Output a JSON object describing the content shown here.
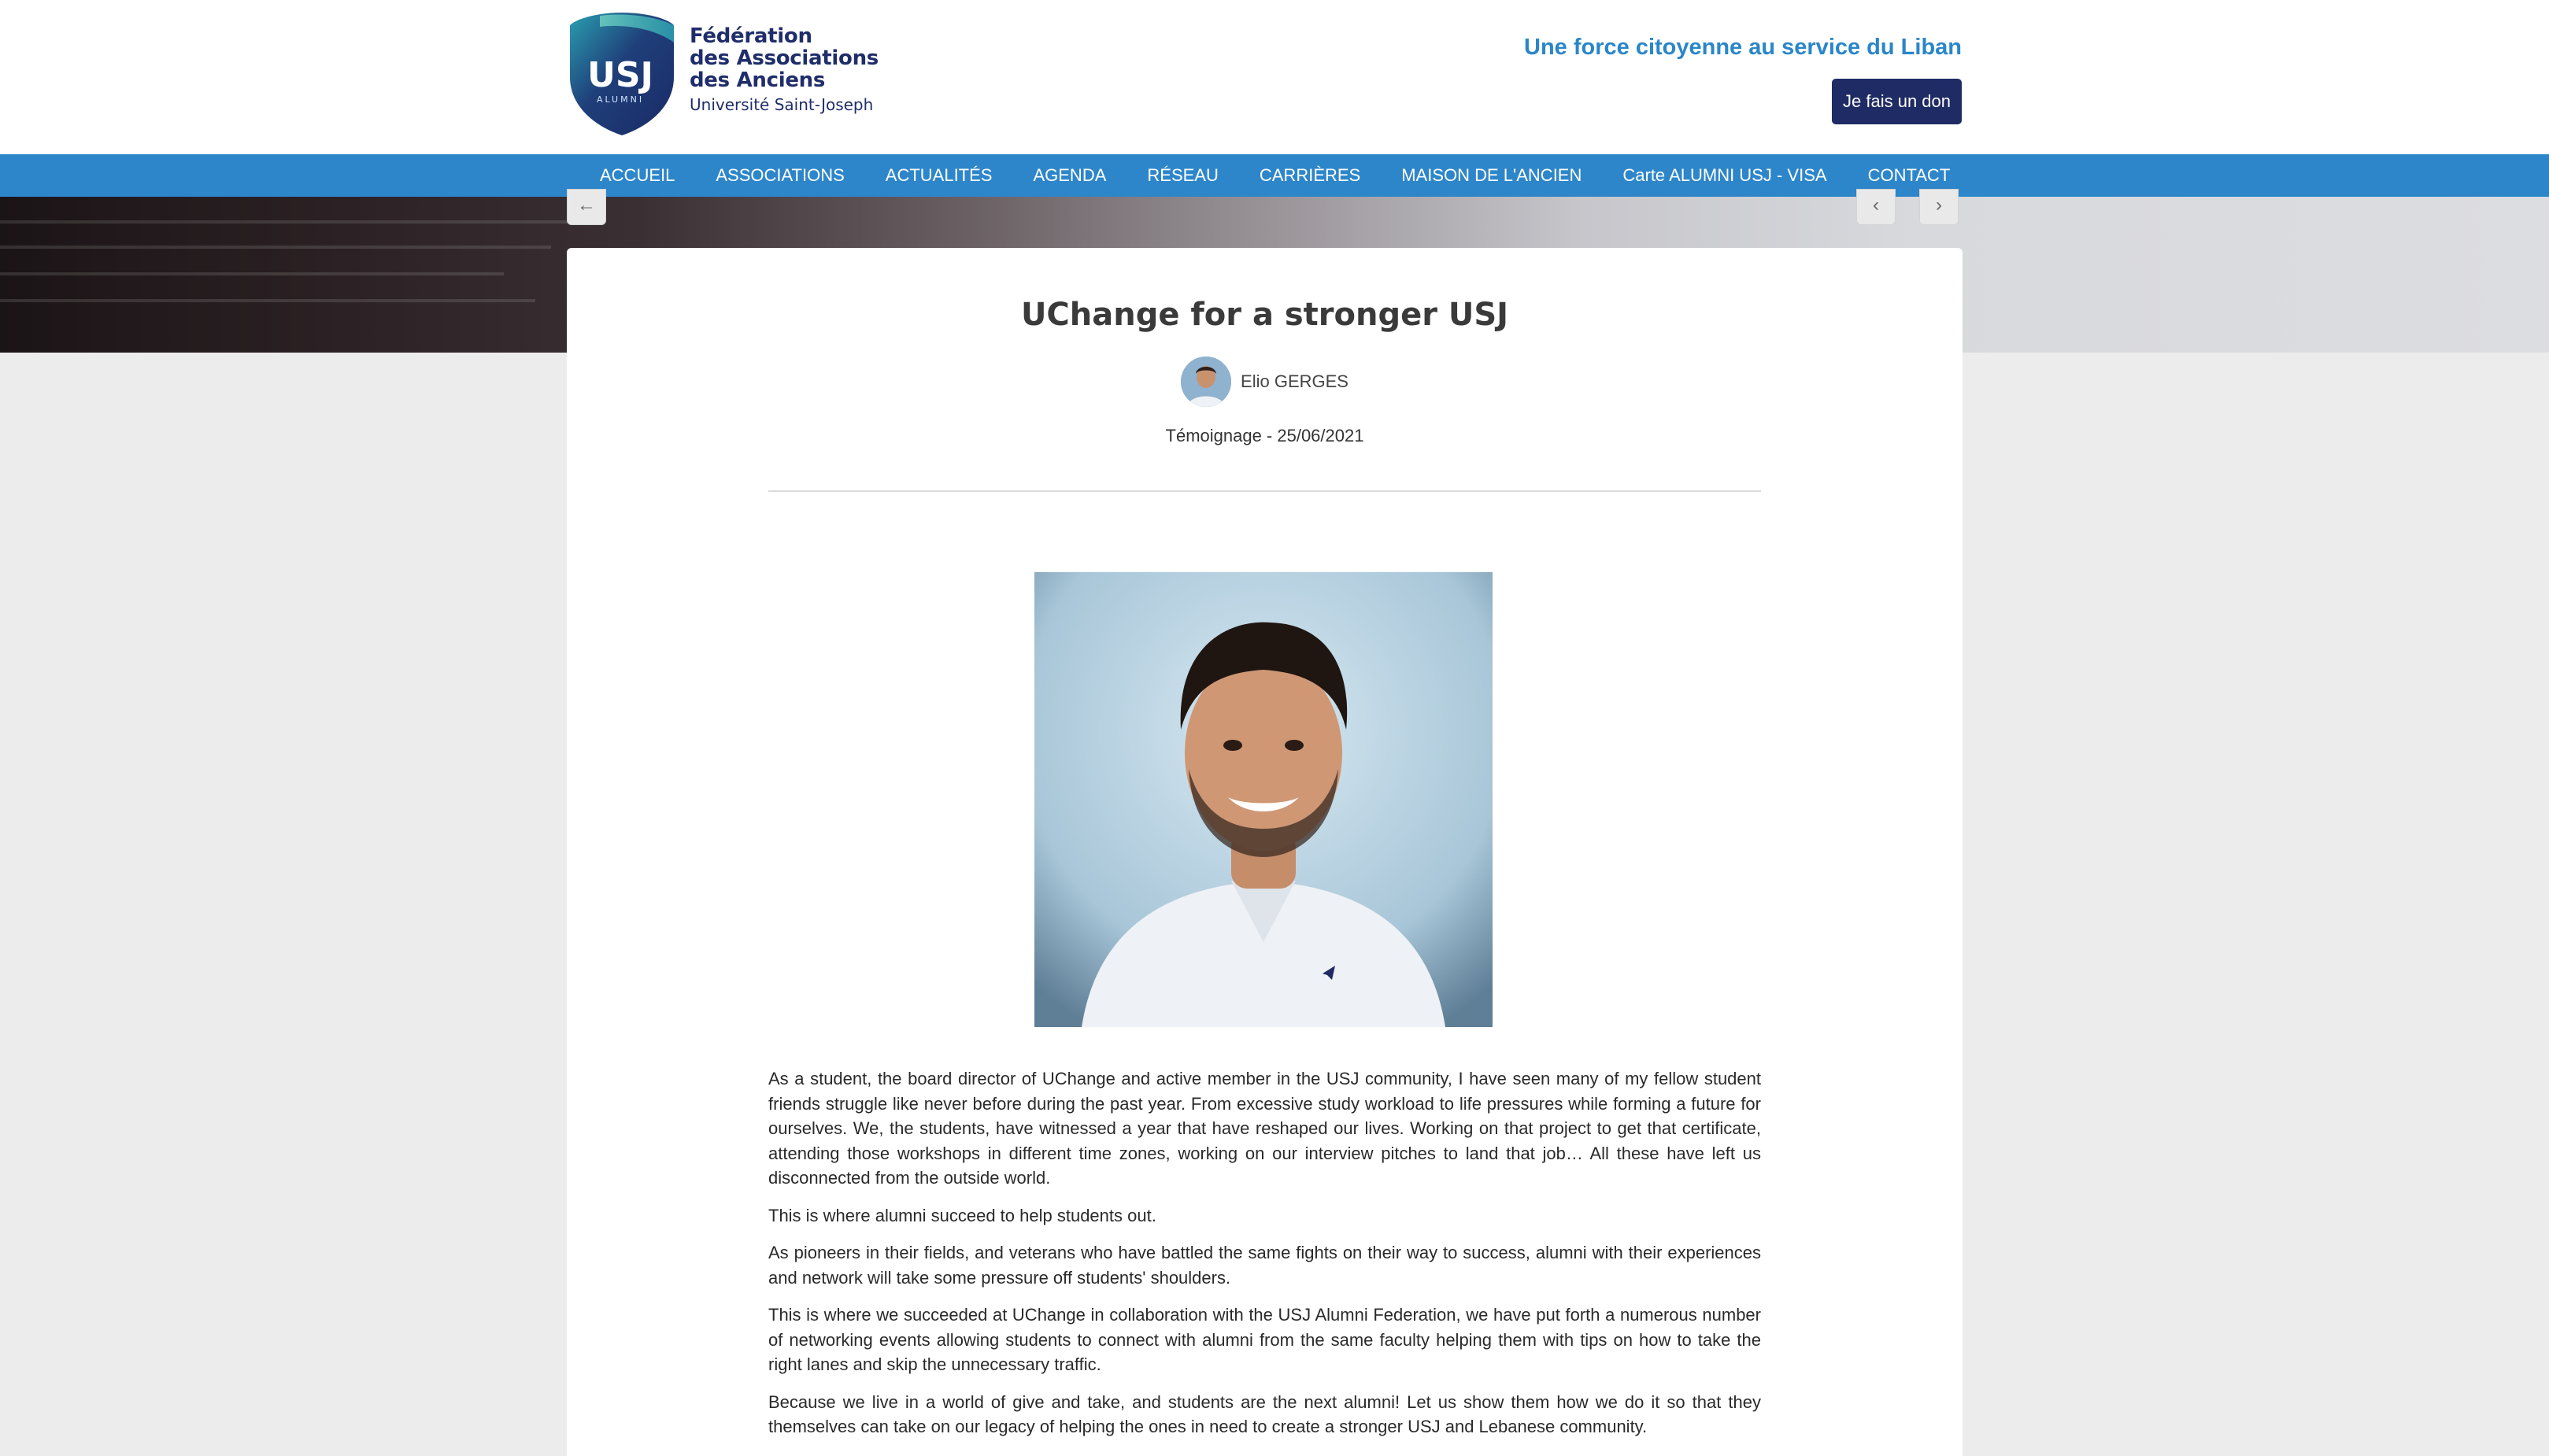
{
  "header": {
    "logo": {
      "shield_text": "USJ",
      "shield_sub": "ALUMNI",
      "lines": [
        "Fédération",
        "des Associations",
        "des Anciens"
      ],
      "sub": "Université Saint-Joseph"
    },
    "tagline": "Une force citoyenne au service du Liban",
    "donate_label": "Je fais un don"
  },
  "nav": {
    "items": [
      "ACCUEIL",
      "ASSOCIATIONS",
      "ACTUALITÉS",
      "AGENDA",
      "RÉSEAU",
      "CARRIÈRES",
      "MAISON DE L'ANCIEN",
      "Carte ALUMNI USJ - VISA",
      "CONTACT"
    ]
  },
  "banner": {
    "back_icon": "arrow-left-icon",
    "prev_icon": "chevron-left-icon",
    "next_icon": "chevron-right-icon"
  },
  "article": {
    "title": "UChange for a stronger USJ",
    "author": "Elio GERGES",
    "meta": "Témoignage - 25/06/2021",
    "paragraphs": [
      "As a student, the board director of UChange and active member in the USJ community, I have seen many of my fellow student friends struggle like never before during the past year. From excessive study workload to life pressures while forming a future for ourselves. We, the students, have witnessed a year that have reshaped our lives. Working on that project to get that certificate, attending those workshops in different time zones, working on our interview pitches to land that job… All these have left us disconnected from the outside world.",
      "This is where alumni succeed to help students out.",
      "As pioneers in their fields, and veterans who have battled the same fights on their way to success, alumni with their experiences and network will take some pressure off students' shoulders.",
      "This is where we succeeded at UChange in collaboration with the USJ Alumni Federation, we have put forth a numerous number of networking events allowing students to connect with alumni from the same faculty helping them with tips on how to take the right lanes and skip the unnecessary traffic.",
      "Because we live in a world of give and take, and students are the next alumni! Let us show them how we do it so that they themselves can take on our legacy of helping the ones in need to create a stronger USJ and Lebanese community."
    ]
  },
  "colors": {
    "nav_bg": "#2d86c9",
    "brand_dark": "#1f2b64",
    "tagline": "#2a86c8"
  }
}
